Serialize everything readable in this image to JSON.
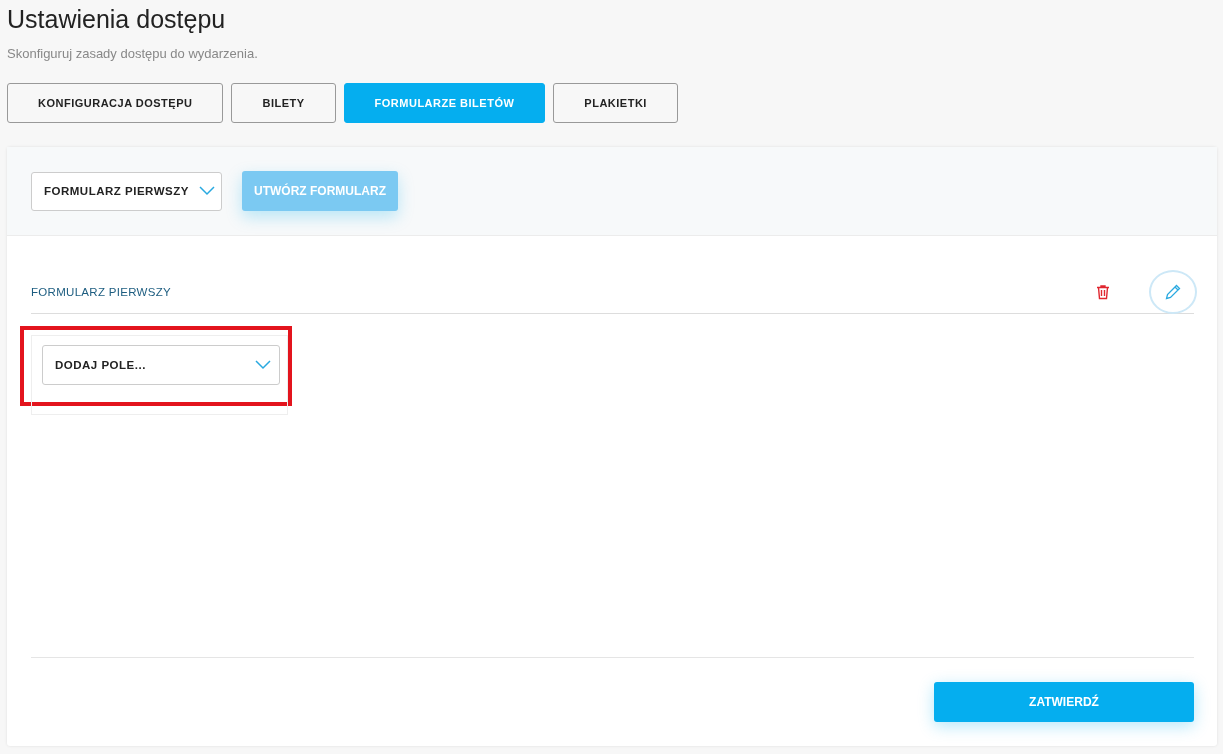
{
  "header": {
    "title": "Ustawienia dostępu",
    "subtitle": "Skonfiguruj zasady dostępu do wydarzenia."
  },
  "tabs": [
    {
      "label": "KONFIGURACJA DOSTĘPU",
      "selected": false
    },
    {
      "label": "BILETY",
      "selected": false
    },
    {
      "label": "FORMULARZE BILETÓW",
      "selected": true
    },
    {
      "label": "PLAKIETKI",
      "selected": false
    }
  ],
  "toolbar": {
    "form_select": {
      "value": "FORMULARZ PIERWSZY"
    },
    "create_button": {
      "label": "UTWÓRZ FORMULARZ",
      "disabled": true
    }
  },
  "form": {
    "title": "FORMULARZ PIERWSZY",
    "add_field": {
      "value": "DODAJ POLE...",
      "highlighted": true
    }
  },
  "submit_button": {
    "label": "ZATWIERDŹ"
  }
}
